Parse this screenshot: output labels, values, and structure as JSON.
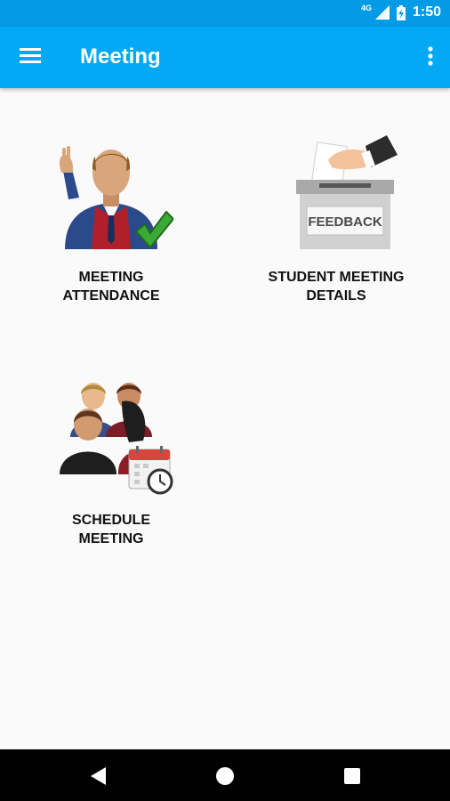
{
  "status_bar": {
    "network": "4G",
    "time": "1:50",
    "icons": [
      "signal-icon",
      "battery-icon"
    ]
  },
  "app_bar": {
    "title": "Meeting",
    "menu_icon": "menu-icon",
    "overflow_icon": "more-vert-icon"
  },
  "tiles": [
    {
      "label_line1": "MEETING",
      "label_line2": "ATTENDANCE",
      "icon": "meeting-attendance-icon"
    },
    {
      "label_line1": "STUDENT MEETING",
      "label_line2": "DETAILS",
      "icon": "feedback-box-icon",
      "box_text": "FEEDBACK"
    },
    {
      "label_line1": "SCHEDULE",
      "label_line2": "MEETING",
      "icon": "schedule-meeting-icon"
    }
  ],
  "nav_bar": {
    "buttons": [
      "back-icon",
      "home-icon",
      "recents-icon"
    ]
  },
  "colors": {
    "status_bar": "#039be5",
    "app_bar": "#03a9f4",
    "background": "#fafafa",
    "nav_bar": "#000000"
  }
}
